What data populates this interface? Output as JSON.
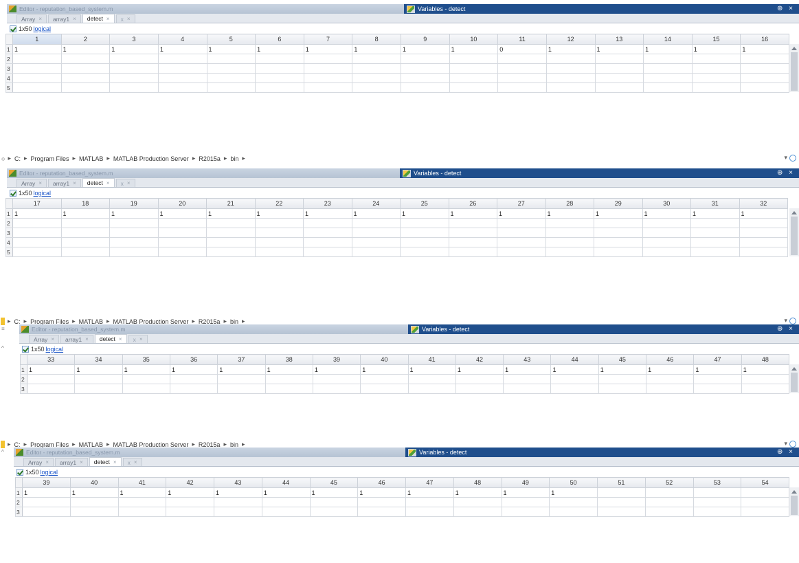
{
  "panels": [
    {
      "has_address": false,
      "editor_title": "Editor - reputation_based_system.m",
      "variables_title": "Variables - detect",
      "window_controls": "⊕ ×",
      "tabs": [
        {
          "label": "Array",
          "close": "×"
        },
        {
          "label": "array1",
          "close": "×"
        },
        {
          "label": "detect",
          "close": "×"
        },
        {
          "label": "x",
          "close": "×"
        }
      ],
      "info_size": "1x50",
      "info_type": "logical",
      "columns": [
        "1",
        "2",
        "3",
        "4",
        "5",
        "6",
        "7",
        "8",
        "9",
        "10",
        "11",
        "12",
        "13",
        "14",
        "15",
        "16"
      ],
      "rows": [
        {
          "label": "1",
          "cells": [
            "1",
            "1",
            "1",
            "1",
            "1",
            "1",
            "1",
            "1",
            "1",
            "1",
            "0",
            "1",
            "1",
            "1",
            "1",
            "1"
          ]
        },
        {
          "label": "2",
          "cells": [
            "",
            "",
            "",
            "",
            "",
            "",
            "",
            "",
            "",
            "",
            "",
            "",
            "",
            "",
            "",
            ""
          ]
        },
        {
          "label": "3",
          "cells": [
            "",
            "",
            "",
            "",
            "",
            "",
            "",
            "",
            "",
            "",
            "",
            "",
            "",
            "",
            "",
            ""
          ]
        },
        {
          "label": "4",
          "cells": [
            "",
            "",
            "",
            "",
            "",
            "",
            "",
            "",
            "",
            "",
            "",
            "",
            "",
            "",
            "",
            ""
          ]
        },
        {
          "label": "5",
          "cells": [
            "",
            "",
            "",
            "",
            "",
            "",
            "",
            "",
            "",
            "",
            "",
            "",
            "",
            "",
            "",
            ""
          ]
        }
      ]
    },
    {
      "has_address": true,
      "address": [
        "C:",
        "Program Files",
        "MATLAB",
        "MATLAB Production Server",
        "R2015a",
        "bin"
      ],
      "editor_title": "Editor - reputation_based_system.m",
      "variables_title": "Variables - detect",
      "window_controls": "⊕ ×",
      "tabs": [
        {
          "label": "Array",
          "close": "×"
        },
        {
          "label": "array1",
          "close": "×"
        },
        {
          "label": "detect",
          "close": "×"
        },
        {
          "label": "x",
          "close": "×"
        }
      ],
      "info_size": "1x50",
      "info_type": "logical",
      "columns": [
        "17",
        "18",
        "19",
        "20",
        "21",
        "22",
        "23",
        "24",
        "25",
        "26",
        "27",
        "28",
        "29",
        "30",
        "31",
        "32"
      ],
      "rows": [
        {
          "label": "1",
          "cells": [
            "1",
            "1",
            "1",
            "1",
            "1",
            "1",
            "1",
            "1",
            "1",
            "1",
            "1",
            "1",
            "1",
            "1",
            "1",
            "1"
          ]
        },
        {
          "label": "2",
          "cells": [
            "",
            "",
            "",
            "",
            "",
            "",
            "",
            "",
            "",
            "",
            "",
            "",
            "",
            "",
            "",
            ""
          ]
        },
        {
          "label": "3",
          "cells": [
            "",
            "",
            "",
            "",
            "",
            "",
            "",
            "",
            "",
            "",
            "",
            "",
            "",
            "",
            "",
            ""
          ]
        },
        {
          "label": "4",
          "cells": [
            "",
            "",
            "",
            "",
            "",
            "",
            "",
            "",
            "",
            "",
            "",
            "",
            "",
            "",
            "",
            ""
          ]
        },
        {
          "label": "5",
          "cells": [
            "",
            "",
            "",
            "",
            "",
            "",
            "",
            "",
            "",
            "",
            "",
            "",
            "",
            "",
            "",
            ""
          ]
        }
      ]
    },
    {
      "has_address": true,
      "address": [
        "C:",
        "Program Files",
        "MATLAB",
        "MATLAB Production Server",
        "R2015a",
        "bin"
      ],
      "editor_title": "Editor - reputation_based_system.m",
      "variables_title": "Variables - detect",
      "window_controls": "⊕ ×",
      "tabs": [
        {
          "label": "Array",
          "close": "×"
        },
        {
          "label": "array1",
          "close": "×"
        },
        {
          "label": "detect",
          "close": "×"
        },
        {
          "label": "x",
          "close": "×"
        }
      ],
      "info_size": "1x50",
      "info_type": "logical",
      "columns": [
        "33",
        "34",
        "35",
        "36",
        "37",
        "38",
        "39",
        "40",
        "41",
        "42",
        "43",
        "44",
        "45",
        "46",
        "47",
        "48"
      ],
      "rows": [
        {
          "label": "1",
          "cells": [
            "1",
            "1",
            "1",
            "1",
            "1",
            "1",
            "1",
            "1",
            "1",
            "1",
            "1",
            "1",
            "1",
            "1",
            "1",
            "1"
          ]
        },
        {
          "label": "2",
          "cells": [
            "",
            "",
            "",
            "",
            "",
            "",
            "",
            "",
            "",
            "",
            "",
            "",
            "",
            "",
            "",
            ""
          ]
        },
        {
          "label": "3",
          "cells": [
            "",
            "",
            "",
            "",
            "",
            "",
            "",
            "",
            "",
            "",
            "",
            "",
            "",
            "",
            "",
            ""
          ]
        }
      ]
    },
    {
      "has_address": true,
      "address": [
        "C:",
        "Program Files",
        "MATLAB",
        "MATLAB Production Server",
        "R2015a",
        "bin"
      ],
      "editor_title": "Editor - reputation_based_system.m",
      "variables_title": "Variables - detect",
      "window_controls": "⊕ ×",
      "tabs": [
        {
          "label": "Array",
          "close": "×"
        },
        {
          "label": "array1",
          "close": "×"
        },
        {
          "label": "detect",
          "close": "×"
        },
        {
          "label": "x",
          "close": "×"
        }
      ],
      "info_size": "1x50",
      "info_type": "logical",
      "columns": [
        "39",
        "40",
        "41",
        "42",
        "43",
        "44",
        "45",
        "46",
        "47",
        "48",
        "49",
        "50",
        "51",
        "52",
        "53",
        "54"
      ],
      "rows": [
        {
          "label": "1",
          "cells": [
            "1",
            "1",
            "1",
            "1",
            "1",
            "1",
            "1",
            "1",
            "1",
            "1",
            "1",
            "1",
            "",
            "",
            "",
            ""
          ]
        },
        {
          "label": "2",
          "cells": [
            "",
            "",
            "",
            "",
            "",
            "",
            "",
            "",
            "",
            "",
            "",
            "",
            "",
            "",
            "",
            ""
          ]
        },
        {
          "label": "3",
          "cells": [
            "",
            "",
            "",
            "",
            "",
            "",
            "",
            "",
            "",
            "",
            "",
            "",
            "",
            "",
            "",
            ""
          ]
        }
      ]
    }
  ]
}
